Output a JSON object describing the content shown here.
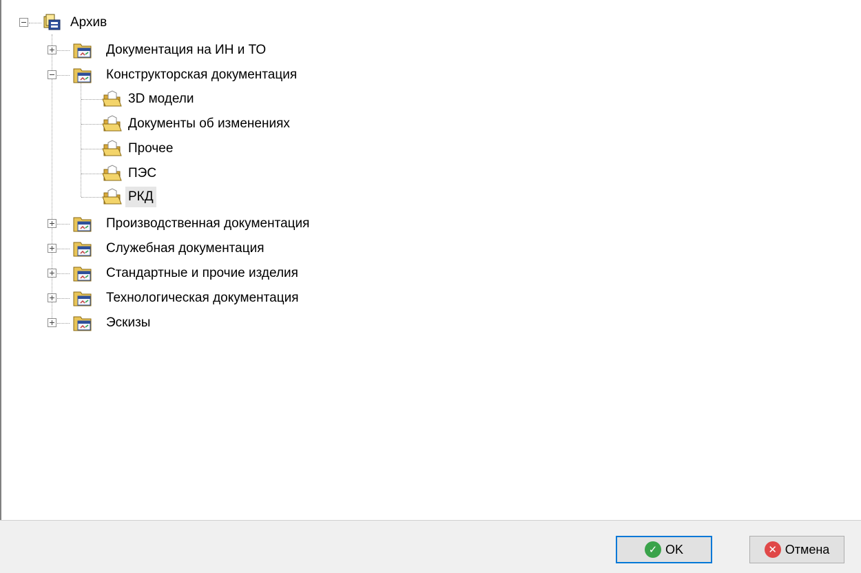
{
  "tree": {
    "root": {
      "label": "Архив",
      "expanded": true
    },
    "children": [
      {
        "label": "Документация на ИН и ТО",
        "expanded": false
      },
      {
        "label": "Конструкторская документация",
        "expanded": true,
        "children": [
          {
            "label": "3D модели"
          },
          {
            "label": "Документы об изменениях"
          },
          {
            "label": "Прочее"
          },
          {
            "label": "ПЭС"
          },
          {
            "label": "РКД",
            "selected": true
          }
        ]
      },
      {
        "label": "Производственная документация",
        "expanded": false
      },
      {
        "label": "Служебная документация",
        "expanded": false
      },
      {
        "label": "Стандартные и прочие изделия",
        "expanded": false
      },
      {
        "label": "Технологическая документация",
        "expanded": false
      },
      {
        "label": "Эскизы",
        "expanded": false
      }
    ]
  },
  "buttons": {
    "ok_label": "OK",
    "cancel_label": "Отмена"
  },
  "icons": {
    "root": "archive-icon",
    "section": "document-folder-icon",
    "subfolder": "open-folder-icon",
    "ok": "check-circle-icon",
    "cancel": "close-circle-icon"
  },
  "colors": {
    "selection": "#e6e6e6",
    "default_button_border": "#0078d7",
    "ok_green": "#3aa34a",
    "cancel_red": "#e04848",
    "folder_yellow": "#e8c458"
  }
}
